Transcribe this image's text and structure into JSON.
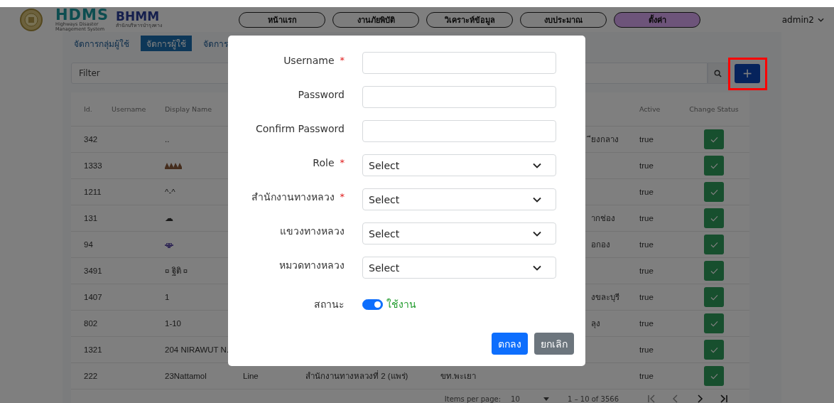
{
  "header": {
    "brand": "HDMS",
    "brand_subtitle": "Highways Disaster Management System",
    "partner_logo": "BHMM",
    "partner_subtitle": "สำนักบริหารบำรุงทาง",
    "nav": [
      {
        "label": "หน้าแรก",
        "selected": false
      },
      {
        "label": "งานภัยพิบัติ",
        "selected": false
      },
      {
        "label": "วิเคราะห์ข้อมูล",
        "selected": false
      },
      {
        "label": "งบประมาณ",
        "selected": false
      },
      {
        "label": "ตั้งค่า",
        "selected": true
      }
    ],
    "user": "admin2"
  },
  "tabs": [
    {
      "label": "จัดการกลุ่มผู้ใช้",
      "selected": false
    },
    {
      "label": "จัดการผู้ใช้",
      "selected": true
    },
    {
      "label": "จัดการ",
      "selected": false
    }
  ],
  "filter": {
    "placeholder": "Filter"
  },
  "add_button": {
    "label": "+",
    "highlighted": true
  },
  "table": {
    "columns": {
      "id": "Id.",
      "username": "Username",
      "display_name": "Display Name",
      "active": "Active",
      "change_status": "Change Status"
    },
    "rows": [
      {
        "id": "342",
        "display": {
          "kind": "text",
          "text": ".."
        },
        "column_7": "ียงกลาง",
        "active": "true"
      },
      {
        "id": "1333",
        "display": {
          "kind": "hands"
        },
        "active": "true"
      },
      {
        "id": "1211",
        "display": {
          "kind": "text",
          "text": "^-^"
        },
        "active": "true"
      },
      {
        "id": "131",
        "display": {
          "kind": "text",
          "text": "☁"
        },
        "column_7": "ากช่อง",
        "active": "true"
      },
      {
        "id": "94",
        "display": {
          "kind": "creature"
        },
        "column_7": "อกอง",
        "active": "true"
      },
      {
        "id": "3491",
        "display": {
          "kind": "text",
          "text": "¤ ฐิติ ¤"
        },
        "active": "true"
      },
      {
        "id": "1407",
        "display": {
          "kind": "text",
          "text": "1"
        },
        "column_7": "งขละบุรี",
        "active": "true"
      },
      {
        "id": "802",
        "display": {
          "kind": "text",
          "text": "1-10"
        },
        "column_7": "ลุง",
        "active": "true"
      },
      {
        "id": "1321",
        "display": {
          "kind": "text",
          "text": "204 NIRAWUT N."
        },
        "active": "true"
      },
      {
        "id": "222",
        "display": {
          "kind": "text",
          "text": "23Nattamol"
        },
        "column_4": "Line",
        "column_5": "สำนักงานทางหลวงที่ 2 (แพร่)",
        "column_6": "ขท.พะเยา",
        "active": "true"
      }
    ]
  },
  "paginator": {
    "items_per_page_label": "Items per page:",
    "items_per_page": "10",
    "range": "1 – 10 of 3566"
  },
  "modal": {
    "fields": [
      {
        "kind": "text",
        "label": "Username",
        "required_mark": "*"
      },
      {
        "kind": "text",
        "label": "Password"
      },
      {
        "kind": "text",
        "label": "Confirm Password"
      },
      {
        "kind": "select",
        "label": "Role",
        "required_mark": "*",
        "value": "Select"
      },
      {
        "kind": "select",
        "label": "สำนักงานทางหลวง",
        "required_mark": "*",
        "value": "Select"
      },
      {
        "kind": "select",
        "label": "แขวงทางหลวง",
        "value": "Select"
      },
      {
        "kind": "select",
        "label": "หมวดทางหลวง",
        "value": "Select"
      }
    ],
    "status": {
      "label": "สถานะ",
      "on": true,
      "text": "ใช้งาน"
    },
    "buttons": [
      {
        "label": "ตกลง",
        "kind": "primary"
      },
      {
        "label": "ยกเลิก",
        "kind": "secondary"
      }
    ]
  }
}
